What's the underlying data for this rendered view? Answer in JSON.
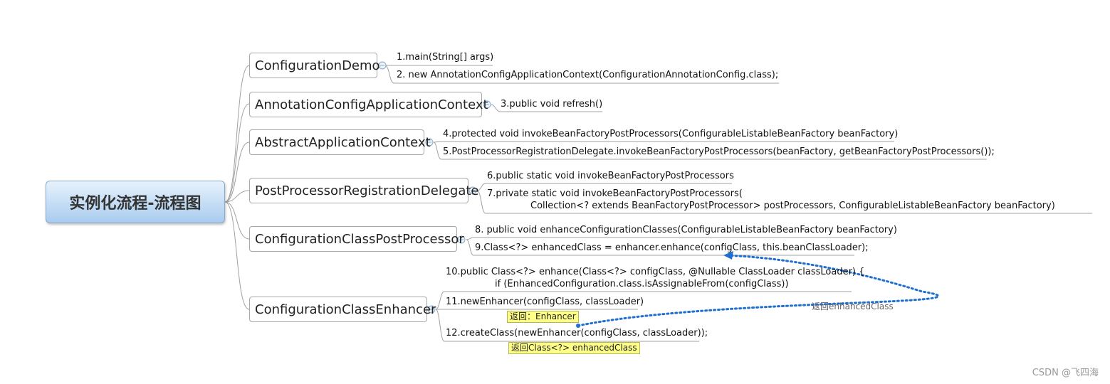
{
  "root": {
    "label": "实例化流程-流程图"
  },
  "nodes": [
    {
      "label": "ConfigurationDemo"
    },
    {
      "label": "AnnotationConfigApplicationContext"
    },
    {
      "label": "AbstractApplicationContext"
    },
    {
      "label": "PostProcessorRegistrationDelegate"
    },
    {
      "label": "ConfigurationClassPostProcessor"
    },
    {
      "label": "ConfigurationClassEnhancer"
    }
  ],
  "leaves": {
    "s1": "1.main(String[] args)",
    "s2": "2. new AnnotationConfigApplicationContext(ConfigurationAnnotationConfig.class);",
    "s3": "3.public void refresh()",
    "s4": "4.protected void invokeBeanFactoryPostProcessors(ConfigurableListableBeanFactory beanFactory)",
    "s5": "5.PostProcessorRegistrationDelegate.invokeBeanFactoryPostProcessors(beanFactory, getBeanFactoryPostProcessors());",
    "s6": "6.public static void invokeBeanFactoryPostProcessors",
    "s7_line1": "7.private static void invokeBeanFactoryPostProcessors(",
    "s7_line2": "Collection<? extends BeanFactoryPostProcessor> postProcessors, ConfigurableListableBeanFactory beanFactory)",
    "s8": "8. public void enhanceConfigurationClasses(ConfigurableListableBeanFactory beanFactory)",
    "s9": "9.Class<?> enhancedClass = enhancer.enhance(configClass, this.beanClassLoader);",
    "s10_line1": "10.public Class<?> enhance(Class<?> configClass, @Nullable ClassLoader classLoader) {",
    "s10_line2": "if (EnhancedConfiguration.class.isAssignableFrom(configClass))",
    "s11": "11.newEnhancer(configClass, classLoader)",
    "s12": "12.createClass(newEnhancer(configClass, classLoader));"
  },
  "callouts": {
    "c11": "返回：Enhancer",
    "c12": "返回Class<?> enhancedClass"
  },
  "relationship": {
    "label": "返回enhancedClass"
  },
  "watermark": "CSDN @飞四海",
  "colors": {
    "branch": "#a0a0a0",
    "relationship": "#1f6fd1",
    "callout_bg": "#ffff88",
    "root_fill": "#c4ddf5"
  }
}
